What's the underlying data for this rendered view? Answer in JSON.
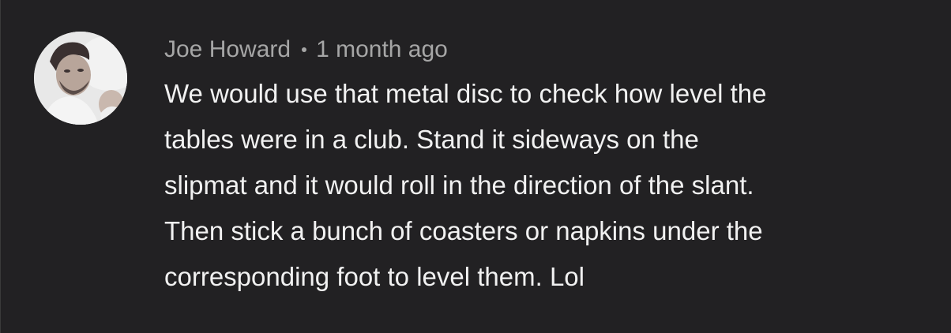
{
  "comment": {
    "author": "Joe Howard",
    "time": "1 month ago",
    "lines": [
      "We would use that metal disc to check how level the",
      "tables were in a club. Stand it sideways on the",
      "slipmat and it would roll in the direction of the slant.",
      "Then stick a bunch of coasters or napkins under the",
      "corresponding foot to level them. Lol"
    ]
  },
  "colors": {
    "background": "#222123",
    "meta_text": "#a6a6a6",
    "body_text": "#f1f1f1"
  }
}
